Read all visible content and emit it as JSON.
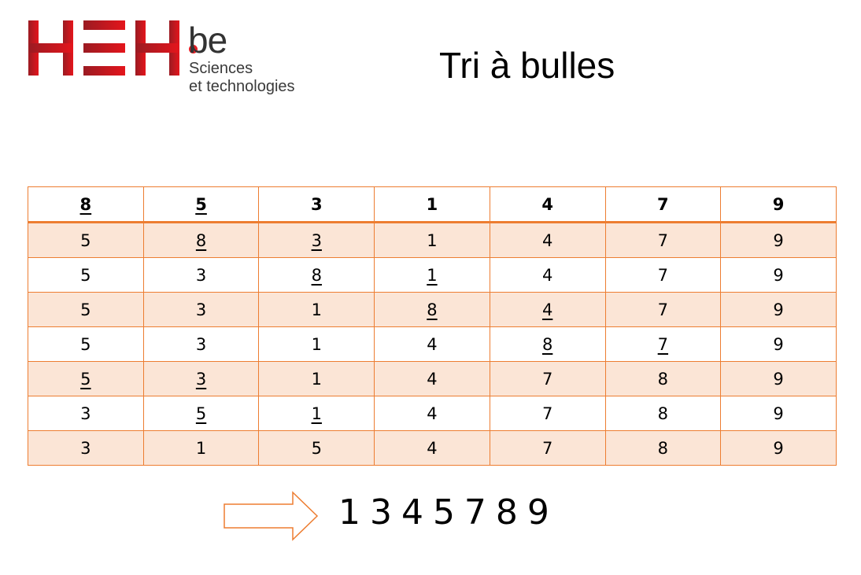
{
  "logo": {
    "brand": "HEH",
    "suffix": "be",
    "subtitle_line1": "Sciences",
    "subtitle_line2": "et technologies"
  },
  "title": "Tri à bulles",
  "colors": {
    "border": "#ED7D31",
    "shade": "#FBE5D6",
    "brand_red": "#E31E24"
  },
  "table": {
    "rows": [
      [
        {
          "v": "8",
          "u": true
        },
        {
          "v": "5",
          "u": true
        },
        {
          "v": "3"
        },
        {
          "v": "1"
        },
        {
          "v": "4"
        },
        {
          "v": "7"
        },
        {
          "v": "9"
        }
      ],
      [
        {
          "v": "5"
        },
        {
          "v": "8",
          "u": true
        },
        {
          "v": "3",
          "u": true
        },
        {
          "v": "1"
        },
        {
          "v": "4"
        },
        {
          "v": "7"
        },
        {
          "v": "9"
        }
      ],
      [
        {
          "v": "5"
        },
        {
          "v": "3"
        },
        {
          "v": "8",
          "u": true
        },
        {
          "v": "1",
          "u": true
        },
        {
          "v": "4"
        },
        {
          "v": "7"
        },
        {
          "v": "9"
        }
      ],
      [
        {
          "v": "5"
        },
        {
          "v": "3"
        },
        {
          "v": "1"
        },
        {
          "v": "8",
          "u": true
        },
        {
          "v": "4",
          "u": true
        },
        {
          "v": "7"
        },
        {
          "v": "9"
        }
      ],
      [
        {
          "v": "5"
        },
        {
          "v": "3"
        },
        {
          "v": "1"
        },
        {
          "v": "4"
        },
        {
          "v": "8",
          "u": true
        },
        {
          "v": "7",
          "u": true
        },
        {
          "v": "9"
        }
      ],
      [
        {
          "v": "5",
          "u": true
        },
        {
          "v": "3",
          "u": true
        },
        {
          "v": "1"
        },
        {
          "v": "4"
        },
        {
          "v": "7"
        },
        {
          "v": "8"
        },
        {
          "v": "9"
        }
      ],
      [
        {
          "v": "3"
        },
        {
          "v": "5",
          "u": true
        },
        {
          "v": "1",
          "u": true
        },
        {
          "v": "4"
        },
        {
          "v": "7"
        },
        {
          "v": "8"
        },
        {
          "v": "9"
        }
      ],
      [
        {
          "v": "3"
        },
        {
          "v": "1"
        },
        {
          "v": "5"
        },
        {
          "v": "4"
        },
        {
          "v": "7"
        },
        {
          "v": "8"
        },
        {
          "v": "9"
        }
      ]
    ]
  },
  "result": "1 3 4 5 7 8 9",
  "icons": {
    "arrow": "right-arrow-outline-icon"
  }
}
